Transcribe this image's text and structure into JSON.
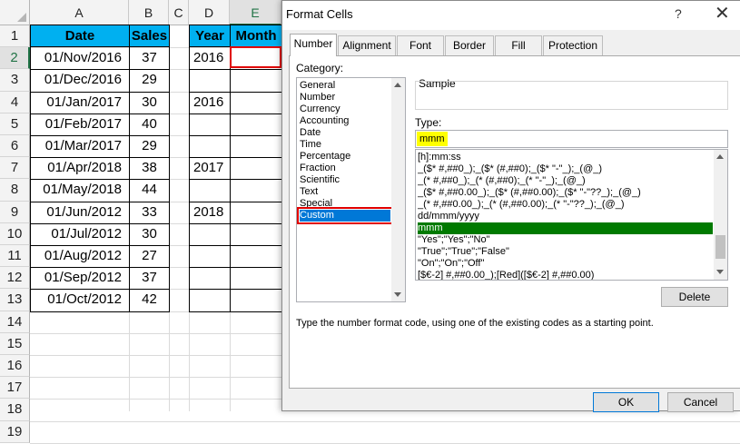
{
  "sheet": {
    "columns": [
      "A",
      "B",
      "C",
      "D",
      "E"
    ],
    "row_numbers": [
      "1",
      "2",
      "3",
      "4",
      "5",
      "6",
      "7",
      "8",
      "9",
      "10",
      "11",
      "12",
      "13",
      "14",
      "15",
      "16",
      "17",
      "18",
      "19"
    ],
    "table1": {
      "headers": [
        "Date",
        "Sales"
      ],
      "rows": [
        [
          "01/Nov/2016",
          "37"
        ],
        [
          "01/Dec/2016",
          "29"
        ],
        [
          "01/Jan/2017",
          "30"
        ],
        [
          "01/Feb/2017",
          "40"
        ],
        [
          "01/Mar/2017",
          "29"
        ],
        [
          "01/Apr/2018",
          "38"
        ],
        [
          "01/May/2018",
          "44"
        ],
        [
          "01/Jun/2012",
          "33"
        ],
        [
          "01/Jul/2012",
          "30"
        ],
        [
          "01/Aug/2012",
          "27"
        ],
        [
          "01/Sep/2012",
          "37"
        ],
        [
          "01/Oct/2012",
          "42"
        ]
      ]
    },
    "table2": {
      "headers": [
        "Year",
        "Month"
      ],
      "years": [
        "2016",
        "",
        "2016",
        "",
        "",
        "2017",
        "",
        "2018",
        "",
        "",
        "",
        ""
      ]
    },
    "colors": {
      "header_fill": "#00b0f0",
      "active_cell_border": "#e00000"
    }
  },
  "dialog": {
    "title": "Format Cells",
    "help": "?",
    "close": "✕",
    "tabs": [
      "Number",
      "Alignment",
      "Font",
      "Border",
      "Fill",
      "Protection"
    ],
    "active_tab": "Number",
    "category_label": "Category:",
    "categories": [
      "General",
      "Number",
      "Currency",
      "Accounting",
      "Date",
      "Time",
      "Percentage",
      "Fraction",
      "Scientific",
      "Text",
      "Special",
      "Custom"
    ],
    "selected_category": "Custom",
    "sample_label": "Sample",
    "type_label": "Type:",
    "type_value": "mmm",
    "formats": [
      "[h]:mm:ss",
      "_($* #,##0_);_($* (#,##0);_($* \"-\"_);_(@_)",
      "_(* #,##0_);_(* (#,##0);_(* \"-\"_);_(@_)",
      "_($* #,##0.00_);_($* (#,##0.00);_($* \"-\"??_);_(@_)",
      "_(* #,##0.00_);_(* (#,##0.00);_(* \"-\"??_);_(@_)",
      "dd/mmm/yyyy",
      "mmm",
      "\"Yes\";\"Yes\";\"No\"",
      "\"True\";\"True\";\"False\"",
      "\"On\";\"On\";\"Off\"",
      "[$€-2] #,##0.00_);[Red]([$€-2] #,##0.00)"
    ],
    "selected_format": "mmm",
    "delete_label": "Delete",
    "hint": "Type the number format code, using one of the existing codes as a starting point.",
    "ok_label": "OK",
    "cancel_label": "Cancel",
    "colors": {
      "selected_category": "#0078d7",
      "selected_format": "#007a00",
      "type_highlight": "#ffff00"
    }
  }
}
